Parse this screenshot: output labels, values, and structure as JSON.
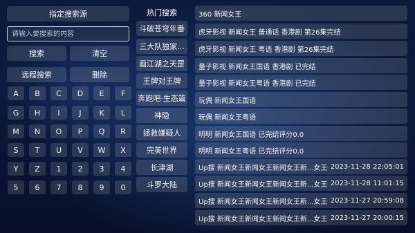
{
  "left_panel": {
    "source_button": "指定搜索源",
    "search_placeholder": "请输入要搜索的内容",
    "search_button": "搜索",
    "clear_button": "清空",
    "remote_search_button": "远程搜索",
    "delete_button": "删除",
    "keys": [
      "A",
      "B",
      "C",
      "D",
      "E",
      "F",
      "G",
      "H",
      "I",
      "J",
      "K",
      "L",
      "M",
      "N",
      "O",
      "P",
      "Q",
      "R",
      "S",
      "T",
      "U",
      "V",
      "W",
      "X",
      "Y",
      "Z",
      "1",
      "2",
      "3",
      "4",
      "5",
      "6",
      "7",
      "8",
      "9",
      "0"
    ]
  },
  "hot": {
    "title": "热门搜索",
    "items": [
      "斗破苍穹年番",
      "三大队独家...",
      "画江湖之天罡",
      "王牌对王牌",
      "奔跑吧·生态篇",
      "神隐",
      "拯救嫌疑人",
      "完美世界",
      "长津湖",
      "斗罗大陆"
    ]
  },
  "results": [
    {
      "text": "360  新闻女王",
      "date": ""
    },
    {
      "text": "虎牙影视  新闻女王 普通话 香港剧 第26集完结",
      "date": ""
    },
    {
      "text": "虎牙影视  新闻女王 粤语 香港剧 第26集完结",
      "date": ""
    },
    {
      "text": "量子影视  新闻女王国语 香港剧 已完结",
      "date": ""
    },
    {
      "text": "量子影视  新闻女王粤语 香港剧 已完结",
      "date": ""
    },
    {
      "text": "玩偶  新闻女王国语",
      "date": ""
    },
    {
      "text": "玩偶  新闻女王粤语",
      "date": ""
    },
    {
      "text": "明明  新闻女王国语  已完结评分0.0",
      "date": ""
    },
    {
      "text": "明明  新闻女王粤语  已完结评分0.0",
      "date": ""
    },
    {
      "text": "Up搜  新闻女王新闻女王新闻女王新...女王新闻女王",
      "date": "2023-11-28 22:05:01"
    },
    {
      "text": "Up搜  新闻女王新闻女王新闻女王新...女王新闻女王",
      "date": "2023-11-28 11:01:15"
    },
    {
      "text": "Up搜  新闻女王新闻女王新闻女王新...女王新闻女王",
      "date": "2023-11-27 20:59:08"
    },
    {
      "text": "Up搜  新闻女王新闻女王新闻女王新...女王新闻女王",
      "date": "2023-11-27 20:00:15"
    }
  ]
}
